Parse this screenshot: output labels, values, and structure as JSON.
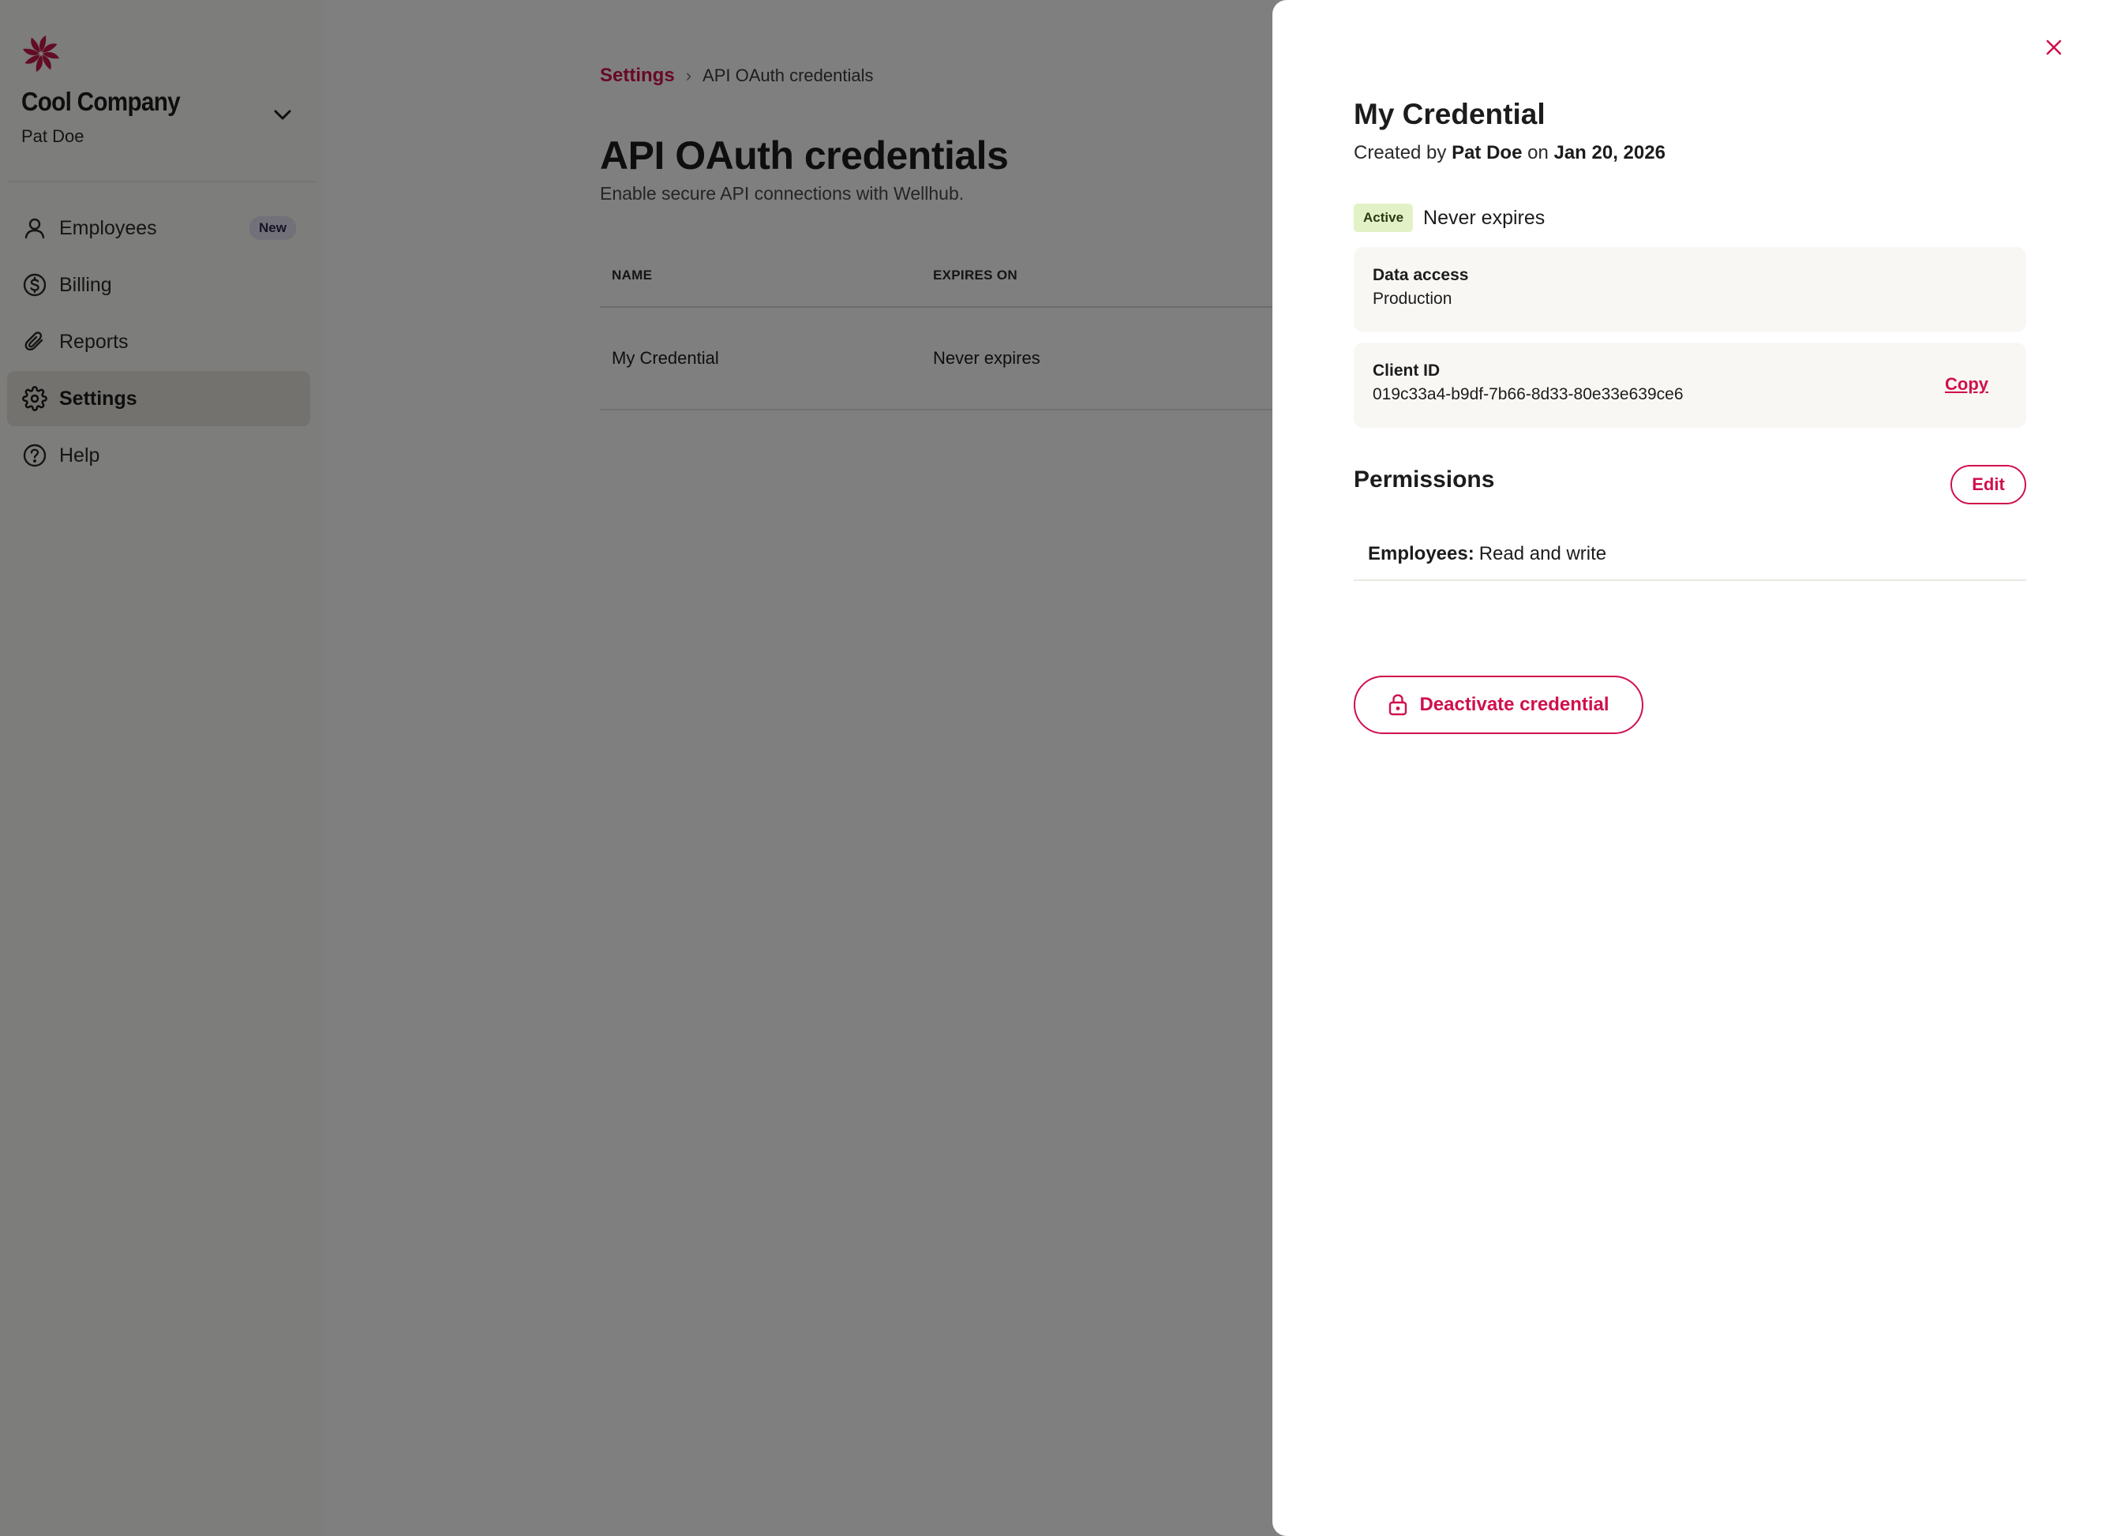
{
  "sidebar": {
    "company_name": "Cool Company",
    "user_name": "Pat Doe",
    "items": [
      {
        "label": "Employees",
        "icon": "person-icon",
        "badge": "New"
      },
      {
        "label": "Billing",
        "icon": "dollar-icon"
      },
      {
        "label": "Reports",
        "icon": "paperclip-icon"
      },
      {
        "label": "Settings",
        "icon": "gear-icon",
        "active": true
      },
      {
        "label": "Help",
        "icon": "help-icon"
      }
    ]
  },
  "main": {
    "breadcrumb": {
      "link": "Settings",
      "current": "API OAuth credentials"
    },
    "title": "API OAuth credentials",
    "subtitle": "Enable secure API connections with Wellhub.",
    "table": {
      "columns": [
        "NAME",
        "EXPIRES ON"
      ],
      "rows": [
        {
          "name": "My Credential",
          "expires": "Never expires"
        }
      ]
    }
  },
  "drawer": {
    "title": "My Credential",
    "created_prefix": "Created by",
    "created_by": "Pat Doe",
    "created_on_word": "on",
    "created_date": "Jan 20, 2026",
    "status": "Active",
    "expiry": "Never expires",
    "data_access": {
      "label": "Data access",
      "value": "Production"
    },
    "client_id": {
      "label": "Client ID",
      "value": "019c33a4-b9df-7b66-8d33-80e33e639ce6",
      "copy_label": "Copy"
    },
    "permissions": {
      "title": "Permissions",
      "edit_label": "Edit",
      "items": [
        {
          "key": "Employees:",
          "value": "Read and write"
        }
      ]
    },
    "deactivate_label": "Deactivate credential"
  },
  "colors": {
    "accent": "#d0104c",
    "active_badge_bg": "#e3f2c6",
    "overlay": "rgba(0,0,0,0.5)",
    "nav_active_bg": "#e6e4df",
    "new_badge_bg": "#e4e1f3"
  }
}
